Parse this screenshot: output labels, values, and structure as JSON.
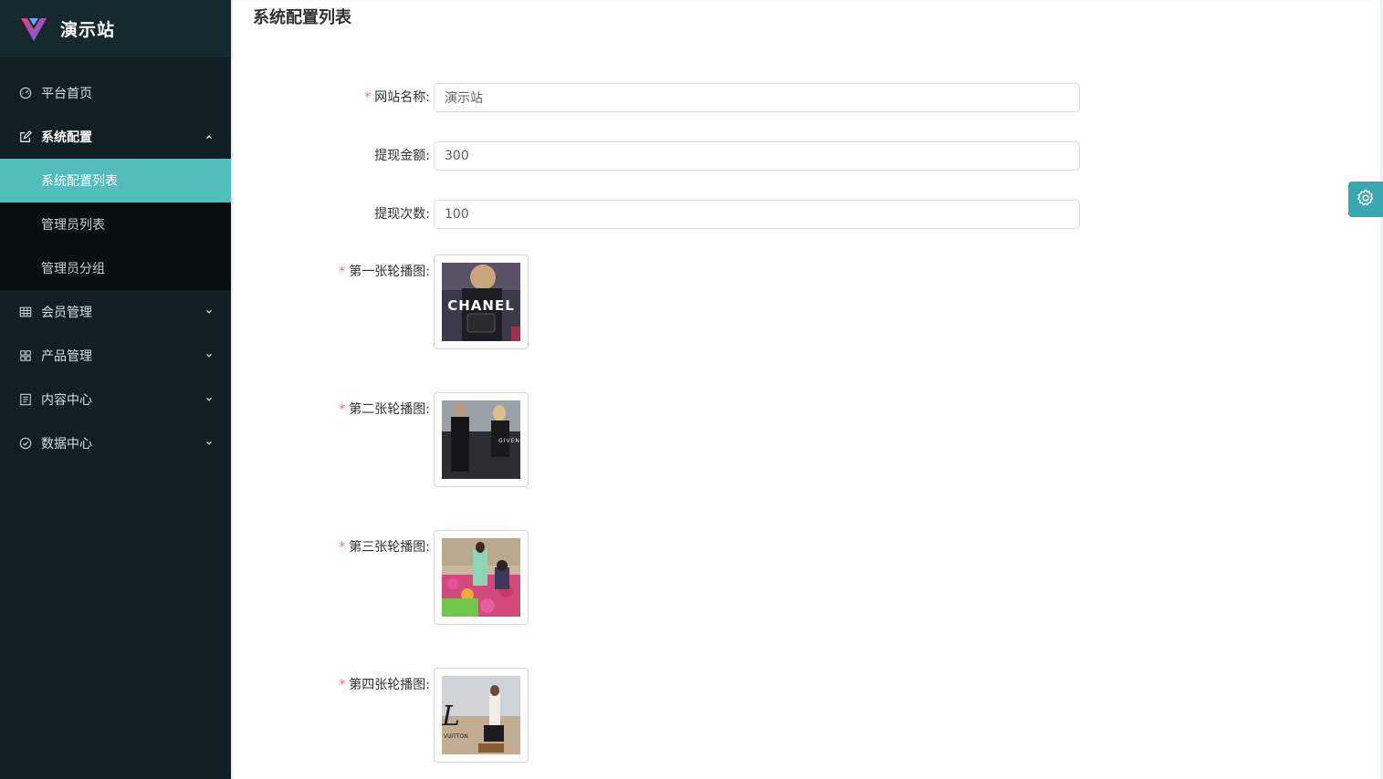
{
  "brand": {
    "title": "演示站"
  },
  "sidebar": {
    "items": [
      {
        "label": "平台首页",
        "icon": "dashboard-icon"
      },
      {
        "label": "系统配置",
        "icon": "edit-icon",
        "open": true,
        "children": [
          {
            "label": "系统配置列表",
            "active": true
          },
          {
            "label": "管理员列表"
          },
          {
            "label": "管理员分组"
          }
        ]
      },
      {
        "label": "会员管理",
        "icon": "grid-icon"
      },
      {
        "label": "产品管理",
        "icon": "apps-icon"
      },
      {
        "label": "内容中心",
        "icon": "document-icon"
      },
      {
        "label": "数据中心",
        "icon": "check-circle-icon"
      }
    ]
  },
  "main": {
    "title": "系统配置列表",
    "form": {
      "site_name": {
        "label": "网站名称:",
        "value": "演示站",
        "required": true
      },
      "withdraw_amount": {
        "label": "提现金额:",
        "value": "300"
      },
      "withdraw_times": {
        "label": "提现次数:",
        "value": "100"
      },
      "banners": [
        {
          "label": "第一张轮播图:",
          "brand_text": "CHANEL"
        },
        {
          "label": "第二张轮播图:",
          "brand_text": "GIVEN"
        },
        {
          "label": "第三张轮播图:",
          "brand_text": ""
        },
        {
          "label": "第四张轮播图:",
          "brand_text": "VUITTON"
        }
      ]
    }
  },
  "colors": {
    "sidebar_bg": "#0f1f24",
    "active": "#53bdbb",
    "required": "#f56c6c",
    "settings_btn": "#3aa8b0"
  }
}
